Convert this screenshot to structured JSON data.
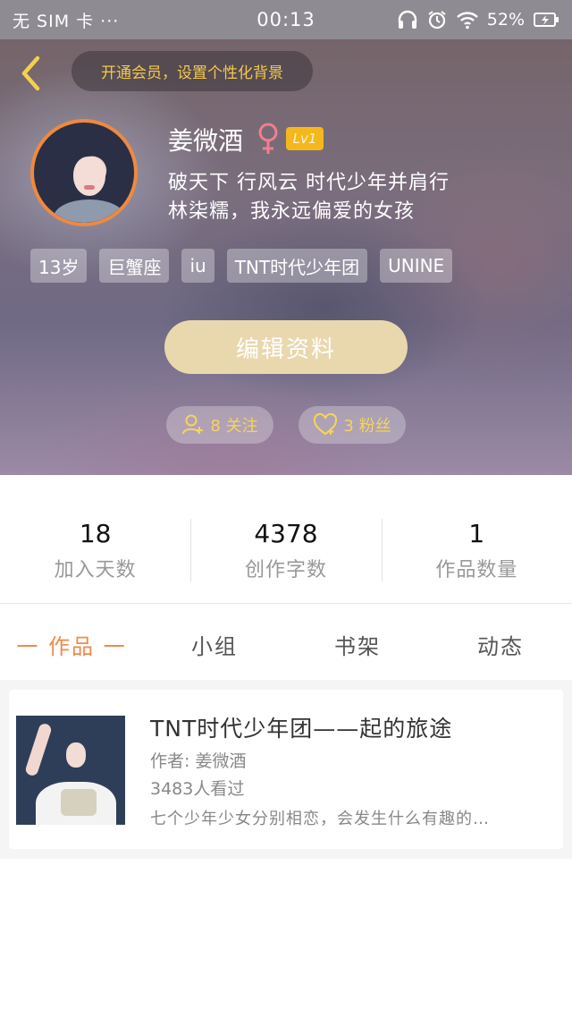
{
  "status_bar": {
    "carrier": "无 SIM 卡 ···",
    "time": "00:13",
    "battery": "52%",
    "icons": [
      "headphones-icon",
      "alarm-icon",
      "wifi-icon",
      "battery-icon"
    ]
  },
  "header": {
    "back_icon": "chevron-left-icon",
    "vip_banner": "开通会员，设置个性化背景",
    "accent_color": "#f3c94c"
  },
  "profile": {
    "name": "姜微酒",
    "gender_icon": "female-icon",
    "level": "Lv1",
    "bio_line1": "破天下 行风云 时代少年并肩行",
    "bio_line2": "林柒糯，我永远偏爱的女孩",
    "tags": [
      "13岁",
      "巨蟹座",
      "iu",
      "TNT时代少年团",
      "UNINE"
    ],
    "edit_button": "编辑资料",
    "follow_text": "8 关注",
    "fans_text": "3 粉丝"
  },
  "stats": [
    {
      "value": "18",
      "label": "加入天数"
    },
    {
      "value": "4378",
      "label": "创作字数"
    },
    {
      "value": "1",
      "label": "作品数量"
    }
  ],
  "tabs": [
    {
      "label": "一 作品 一",
      "active": true
    },
    {
      "label": "小组",
      "active": false
    },
    {
      "label": "书架",
      "active": false
    },
    {
      "label": "动态",
      "active": false
    }
  ],
  "works": [
    {
      "title": "TNT时代少年团——起的旅途",
      "author": "作者: 姜微酒",
      "views": "3483人看过",
      "description": "七个少年少女分别相恋，会发生什么有趣的…"
    }
  ]
}
